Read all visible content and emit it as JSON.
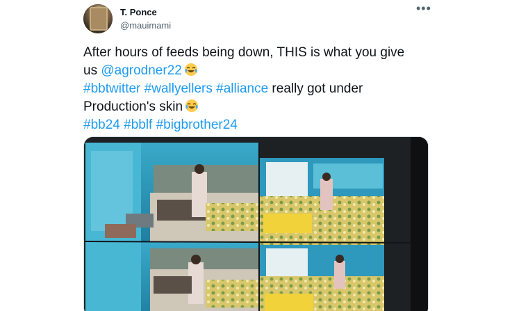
{
  "tweet": {
    "author_name": "T. Ponce",
    "author_handle": "@mauimami",
    "more_icon": "•••",
    "lines": {
      "l1": "After hours of feeds being down, THIS is what you give",
      "l2_text": "us ",
      "l2_mention": "@agrodner22",
      "l3_tag1": "#bbtwitter",
      "l3_tag2": "#wallyellers",
      "l3_tag3": "#alliance",
      "l3_text": " really got under",
      "l4_text": "Production's skin",
      "l5_tag1": "#bb24",
      "l5_tag2": "#bblf",
      "l5_tag3": "#bigbrother24"
    },
    "emoji_icon": "face-with-tears-of-joy-icon",
    "media_icon": "tv-screen-photo"
  },
  "colors": {
    "link": "#1d9bf0",
    "text": "#0f1419",
    "secondary": "#536471"
  }
}
